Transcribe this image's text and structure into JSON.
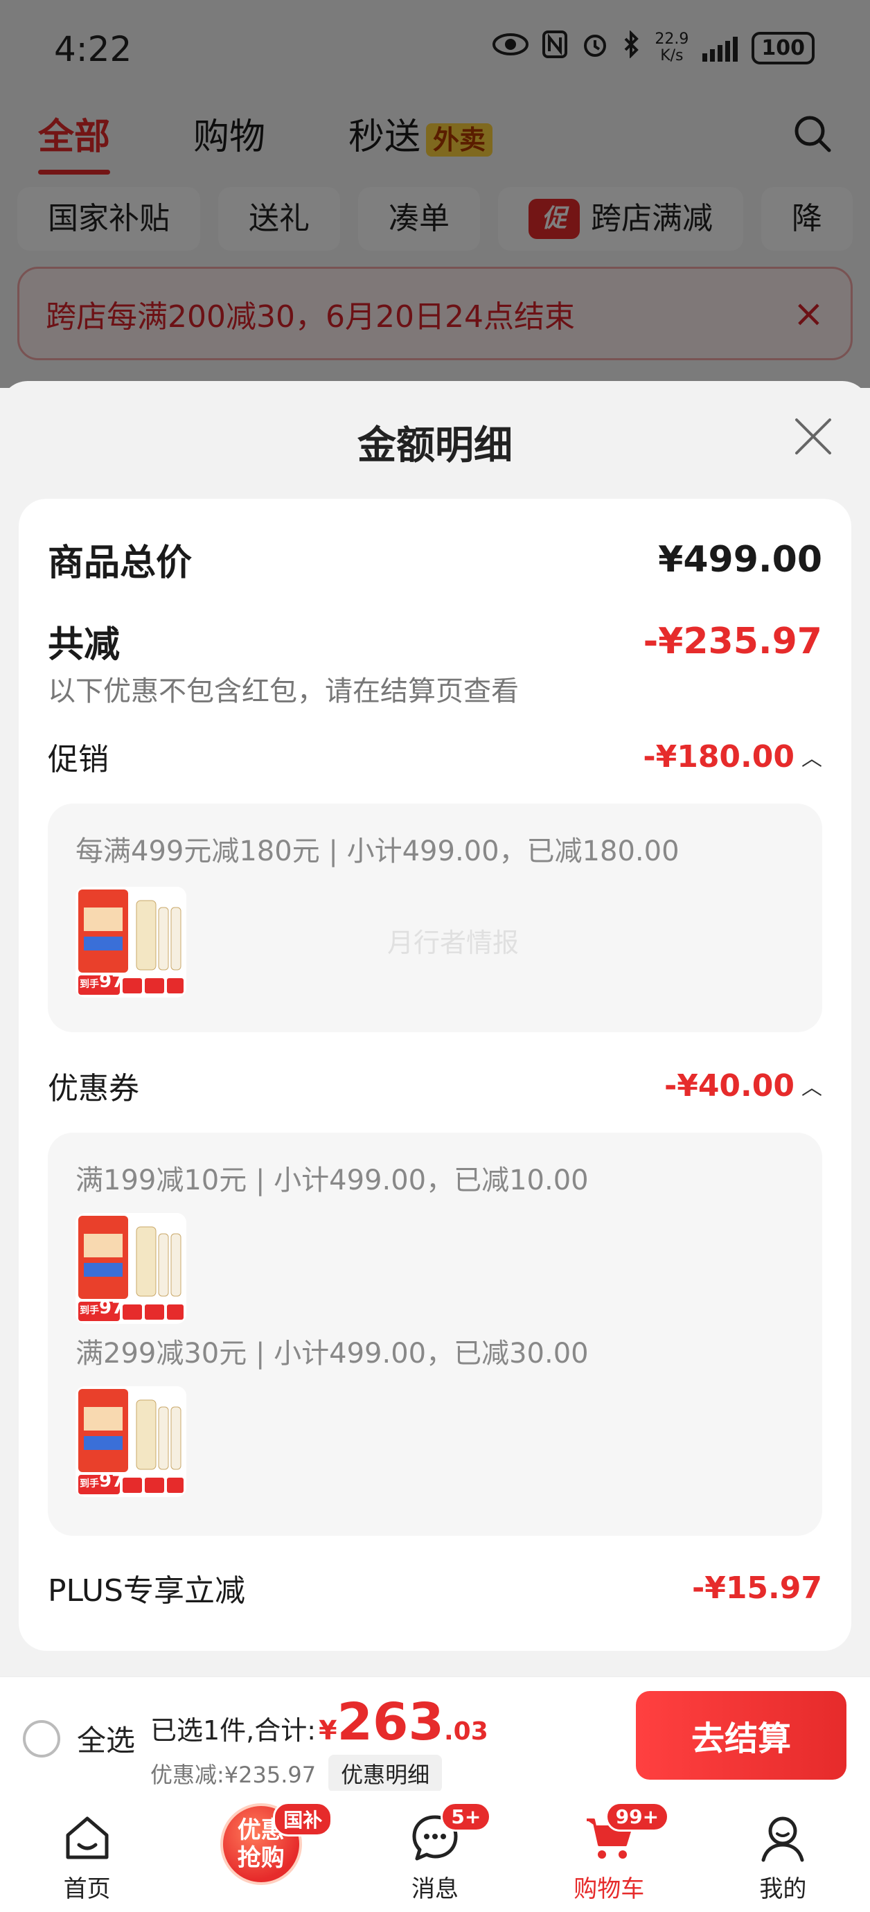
{
  "status_bar": {
    "time": "4:22",
    "net_speed_value": "22.9",
    "net_speed_unit": "K/s",
    "battery": "100"
  },
  "top_tabs": {
    "all": "全部",
    "shopping": "购物",
    "express": "秒送",
    "express_badge": "外卖"
  },
  "chips": [
    {
      "label": "国家补贴"
    },
    {
      "label": "送礼"
    },
    {
      "label": "凑单"
    },
    {
      "label": "跨店满减",
      "icon_text": "促"
    },
    {
      "label": "降"
    }
  ],
  "promo_banner": {
    "text": "跨店每满200减30，6月20日24点结束",
    "close": "×"
  },
  "sheet": {
    "title": "金额明细",
    "total_label": "商品总价",
    "total_value": "¥499.00",
    "reduce_label": "共减",
    "reduce_value": "-¥235.97",
    "reduce_note": "以下优惠不包含红包，请在结算页查看",
    "promotion": {
      "label": "促销",
      "value": "-¥180.00",
      "rule": "每满499元减180元 | 小计499.00，已减180.00"
    },
    "watermark": "月行者情报",
    "coupon": {
      "label": "优惠券",
      "value": "-¥40.00",
      "rules": [
        "满199减10元 | 小计499.00，已减10.00",
        "满299减30元 | 小计499.00，已减30.00"
      ]
    },
    "plus": {
      "label": "PLUS专享立减",
      "value": "-¥15.97"
    }
  },
  "product_thumb": {
    "tag_price": "97",
    "tag_prefix": "到手"
  },
  "checkout": {
    "select_all": "全选",
    "selected_text": "已选1件,合计:",
    "currency": "¥",
    "total_int": "263",
    "total_dec": ".03",
    "discount_text": "优惠减:¥235.97",
    "discount_link": "优惠明细",
    "button": "去结算"
  },
  "bottom_nav": {
    "home": "首页",
    "promo_line1": "优惠",
    "promo_line2": "抢购",
    "promo_badge": "国补",
    "messages": "消息",
    "messages_badge": "5+",
    "cart": "购物车",
    "cart_badge": "99+",
    "mine": "我的"
  },
  "colors": {
    "accent_red": "#e62b2b",
    "badge_yellow": "#ffd23f"
  }
}
